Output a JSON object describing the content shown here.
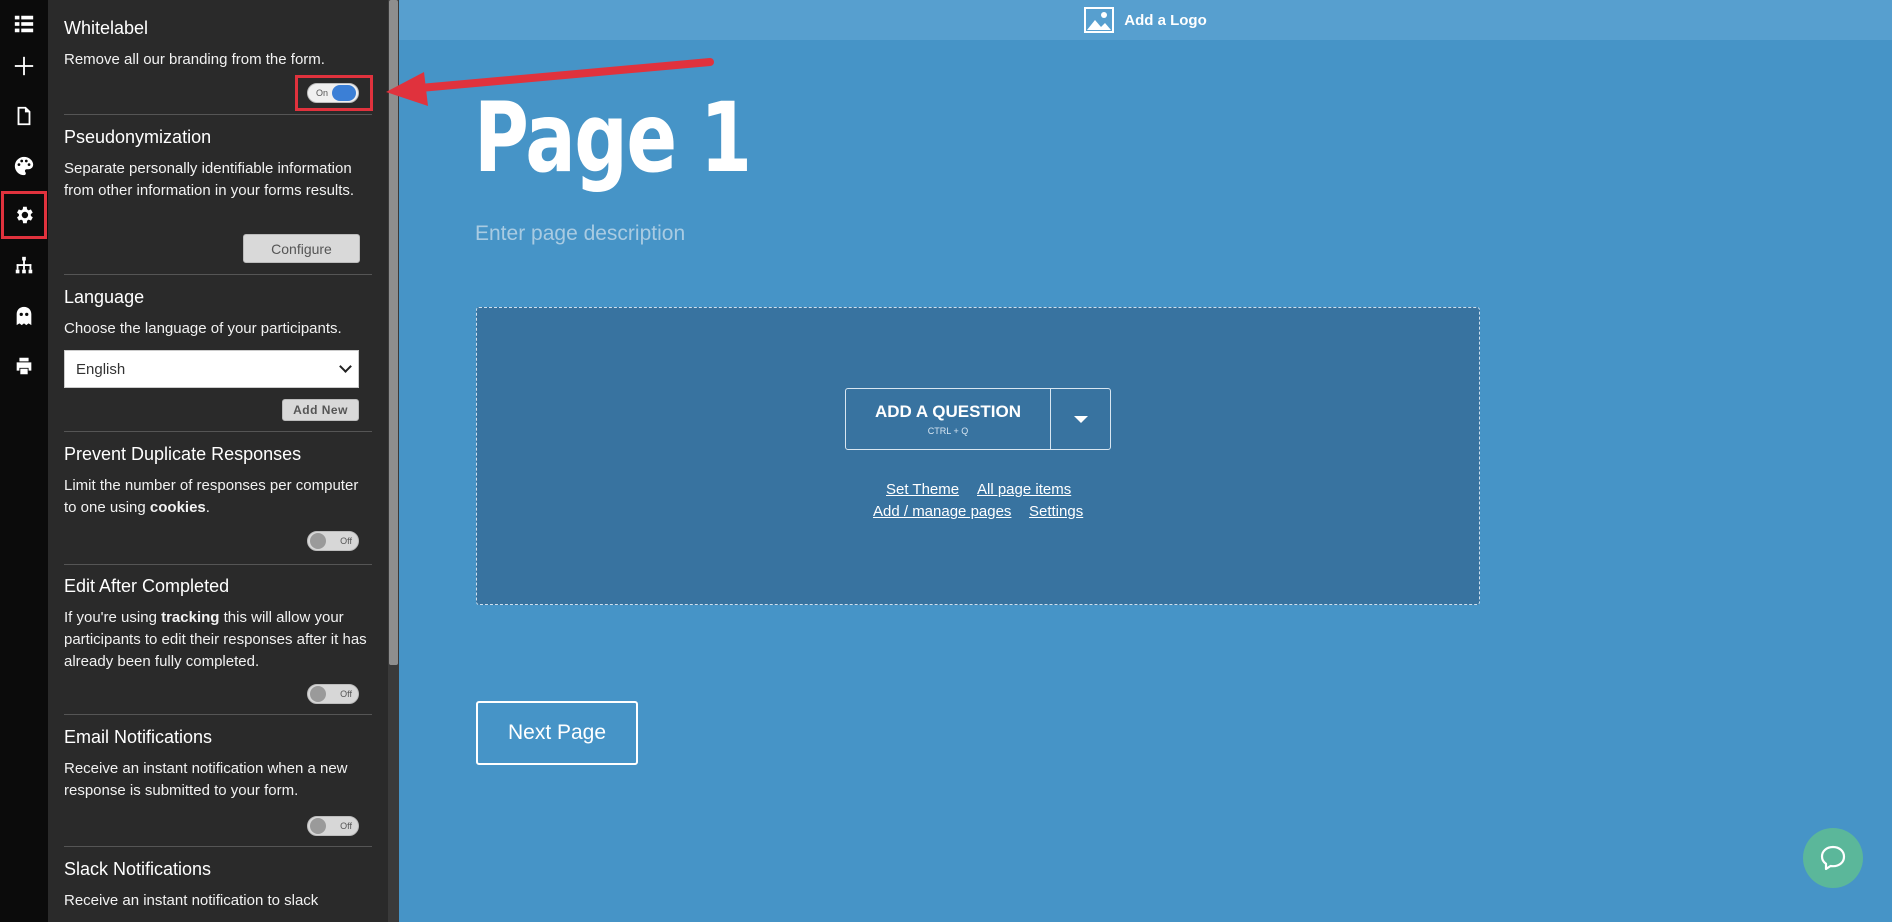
{
  "sidebar_icons": [
    {
      "name": "list-icon"
    },
    {
      "name": "plus-icon"
    },
    {
      "name": "document-icon"
    },
    {
      "name": "palette-icon"
    },
    {
      "name": "gear-icon",
      "active": true
    },
    {
      "name": "sitemap-icon"
    },
    {
      "name": "ghost-icon"
    },
    {
      "name": "print-icon"
    }
  ],
  "settings": {
    "whitelabel": {
      "title": "Whitelabel",
      "desc": "Remove all our branding from the form.",
      "toggle": "On"
    },
    "pseudonymization": {
      "title": "Pseudonymization",
      "desc": "Separate personally identifiable information from other information in your forms results.",
      "button": "Configure"
    },
    "language": {
      "title": "Language",
      "desc": "Choose the language of your participants.",
      "selected": "English",
      "add_button": "Add New"
    },
    "duplicate": {
      "title": "Prevent Duplicate Responses",
      "desc_before": "Limit the number of responses per computer to one using ",
      "desc_bold": "cookies",
      "desc_after": ".",
      "toggle": "Off"
    },
    "edit_after": {
      "title": "Edit After Completed",
      "desc_before": "If you're using ",
      "desc_bold": "tracking",
      "desc_after": " this will allow your participants to edit their responses after it has already been fully completed.",
      "toggle": "Off"
    },
    "email": {
      "title": "Email Notifications",
      "desc": "Receive an instant notification when a new response is submitted to your form.",
      "toggle": "Off"
    },
    "slack": {
      "title": "Slack Notifications",
      "desc": "Receive an instant notification to slack"
    }
  },
  "canvas": {
    "logo_label": "Add a Logo",
    "page_title": "Page 1",
    "page_description": "Enter page description",
    "add_question": "ADD A QUESTION",
    "add_question_shortcut": "CTRL + Q",
    "link_set_theme": "Set Theme",
    "link_all_items": "All page items",
    "link_manage_pages": "Add / manage pages",
    "link_settings": "Settings",
    "next_page": "Next Page"
  },
  "colors": {
    "canvas_bg": "#4694c7",
    "panel_bg": "#2a2a2a",
    "highlight": "#e0323d",
    "toggle_on": "#3b7fd6",
    "chat": "#5bb79a"
  }
}
